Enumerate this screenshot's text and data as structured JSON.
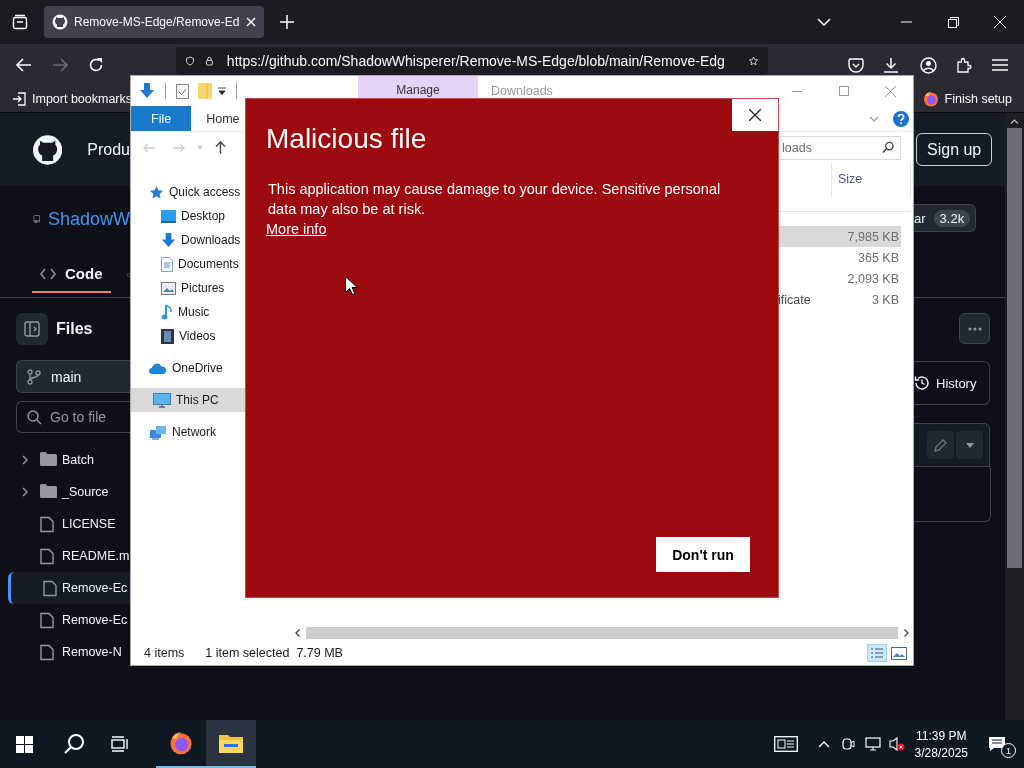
{
  "browser": {
    "tab": {
      "title": "Remove-MS-Edge/Remove-Ed",
      "selected": true
    },
    "address": "https://github.com/ShadowWhisperer/Remove-MS-Edge/blob/main/Remove-Edg",
    "bookmarks": [
      {
        "label": "Import bookmarks",
        "kind": "import"
      },
      {
        "label": "Finish setup",
        "kind": "firefox"
      }
    ]
  },
  "github": {
    "nav_item": "Produ",
    "sign_up": "Sign up",
    "repo_name": "ShadowW",
    "star": {
      "label": "ar",
      "count": "3.2k"
    },
    "tabs": [
      {
        "label": "Code",
        "selected": true
      }
    ],
    "files_title": "Files",
    "branch": "main",
    "file_search_placeholder": "Go to file",
    "tree": [
      {
        "name": "Batch",
        "kind": "folder",
        "selected": false
      },
      {
        "name": "_Source",
        "kind": "folder",
        "selected": false
      },
      {
        "name": "LICENSE",
        "kind": "file",
        "selected": false
      },
      {
        "name": "README.m",
        "kind": "file",
        "selected": false
      },
      {
        "name": "Remove-Ec",
        "kind": "file",
        "selected": true
      },
      {
        "name": "Remove-Ec",
        "kind": "file",
        "selected": false
      },
      {
        "name": "Remove-N",
        "kind": "file",
        "selected": false
      }
    ],
    "history": "History"
  },
  "explorer": {
    "title": "Downloads",
    "context_tab": "Manage",
    "ribbon_tabs": [
      {
        "label": "File",
        "kind": "file"
      },
      {
        "label": "Home",
        "kind": "tab"
      }
    ],
    "search_placeholder": "loads",
    "nav": [
      {
        "label": "Quick access",
        "kind": "star",
        "selected": false,
        "children": [
          {
            "label": "Desktop",
            "kind": "desktop",
            "selected": false
          },
          {
            "label": "Downloads",
            "kind": "download",
            "selected": false
          },
          {
            "label": "Documents",
            "kind": "document",
            "selected": false
          },
          {
            "label": "Pictures",
            "kind": "picture",
            "selected": false
          },
          {
            "label": "Music",
            "kind": "music",
            "selected": false
          },
          {
            "label": "Videos",
            "kind": "video",
            "selected": false
          }
        ]
      },
      {
        "label": "OneDrive",
        "kind": "cloud",
        "selected": false
      },
      {
        "label": "This PC",
        "kind": "pc",
        "selected": true
      },
      {
        "label": "Network",
        "kind": "network",
        "selected": false
      }
    ],
    "columns": [
      "Size"
    ],
    "rows": [
      {
        "size": "7,985 KB",
        "selected": true
      },
      {
        "size": "365 KB",
        "selected": false
      },
      {
        "size": "2,093 KB",
        "selected": false
      },
      {
        "column_1": "ificate",
        "size": "3 KB",
        "selected": false
      }
    ],
    "status": [
      "4 items",
      "1 item selected",
      "7.79 MB"
    ]
  },
  "dialog": {
    "title": "Malicious file",
    "message": "This application may cause damage to your device. Sensitive personal data may also be at risk.",
    "link": "More info",
    "button": "Don't run"
  },
  "taskbar": {
    "apps": [
      {
        "kind": "firefox",
        "active": false
      },
      {
        "kind": "explorer",
        "active": true
      }
    ],
    "time": "11:39 PM",
    "date": "3/28/2025",
    "notifications": "1"
  }
}
